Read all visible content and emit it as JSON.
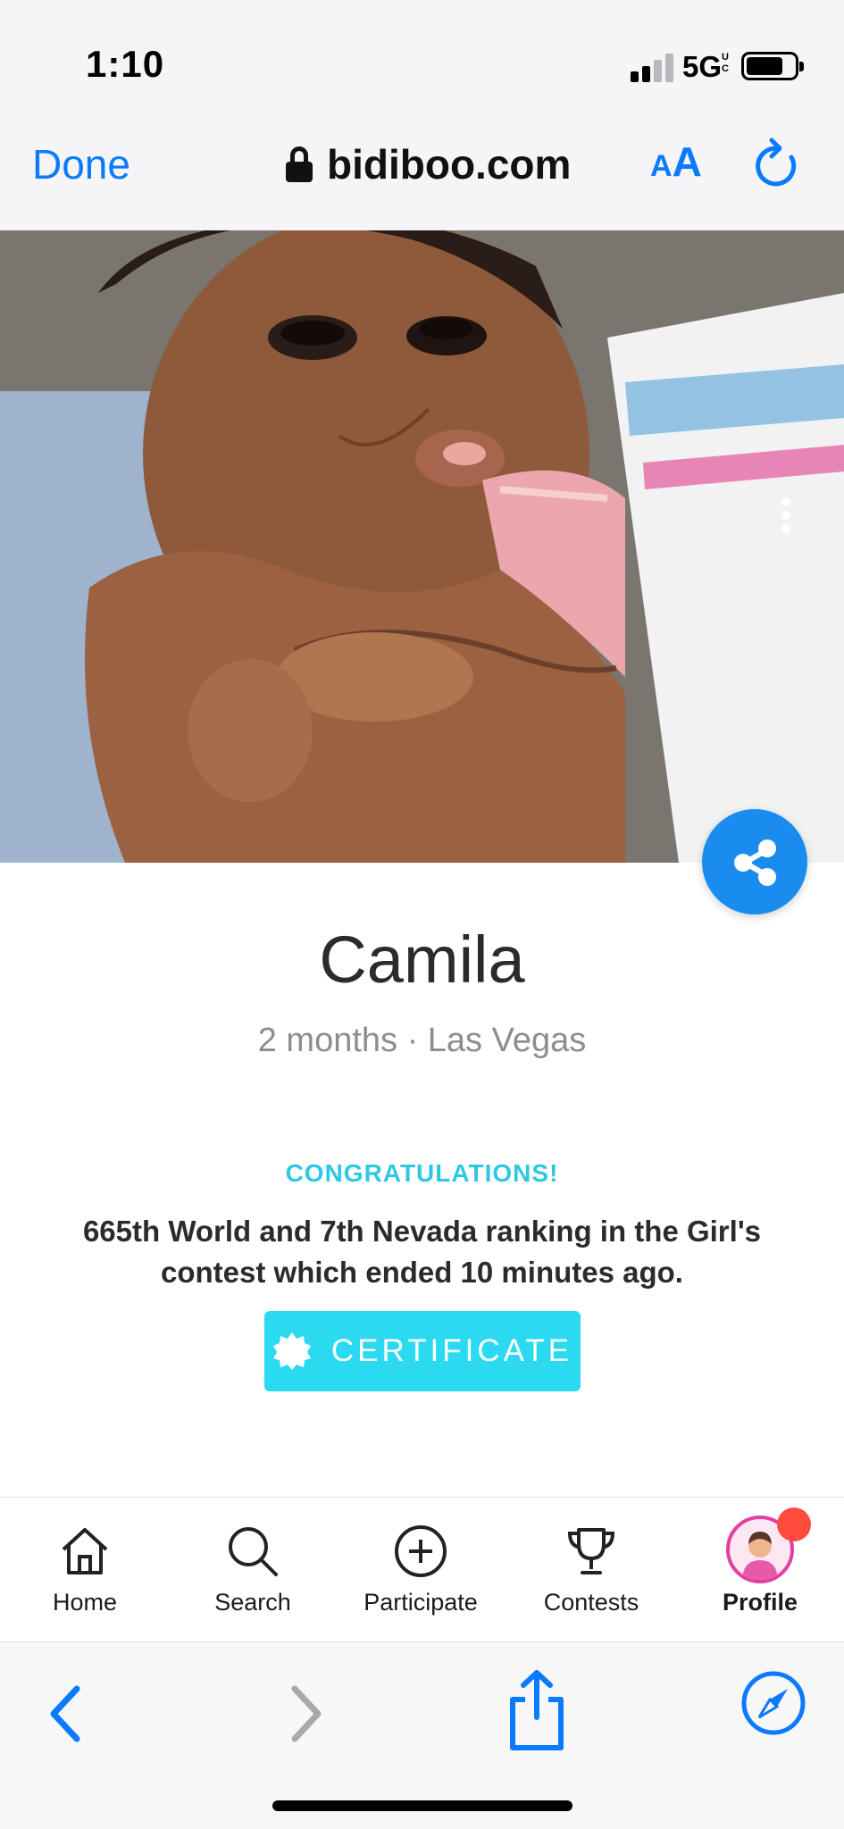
{
  "status_bar": {
    "time": "1:10",
    "network": "5G",
    "network_suffix": "UC"
  },
  "browser": {
    "done_label": "Done",
    "url": "bidiboo.com",
    "text_size_small": "A",
    "text_size_large": "A"
  },
  "profile": {
    "name": "Camila",
    "meta": "2 months · Las Vegas"
  },
  "result": {
    "heading": "CONGRATULATIONS!",
    "message": "665th World and 7th Nevada ranking in the Girl's contest which ended 10 minutes ago.",
    "certificate_label": "CERTIFICATE"
  },
  "tabs": [
    {
      "label": "Home",
      "icon": "home-icon"
    },
    {
      "label": "Search",
      "icon": "search-icon"
    },
    {
      "label": "Participate",
      "icon": "plus-circle-icon"
    },
    {
      "label": "Contests",
      "icon": "trophy-icon"
    },
    {
      "label": "Profile",
      "icon": "avatar"
    }
  ],
  "colors": {
    "ios_blue": "#0a7aff",
    "accent_cyan": "#2bdaf0",
    "share_blue": "#1a8cf0",
    "notification_red": "#ff4b3b",
    "avatar_ring": "#e23fa3"
  }
}
